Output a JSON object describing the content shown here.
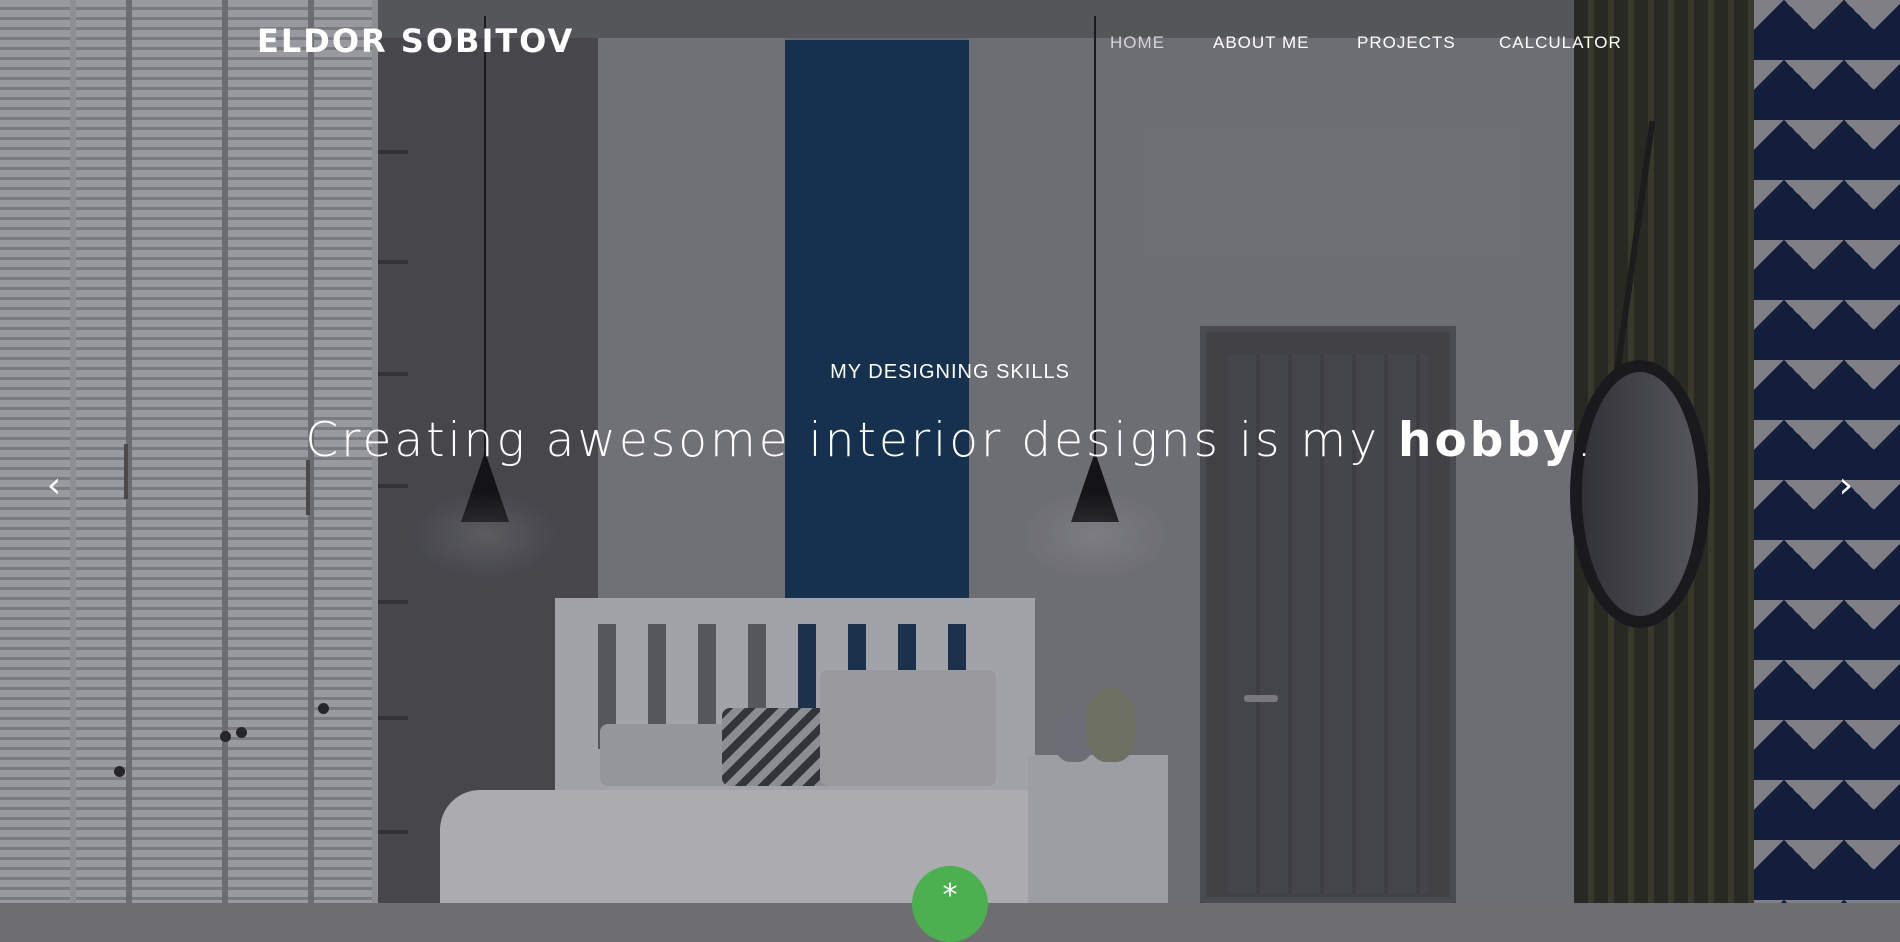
{
  "brand": "ELDOR SOBITOV",
  "nav": {
    "home": "HOME",
    "about": "ABOUT ME",
    "projects": "PROJECTS",
    "calculator": "CALCULATOR",
    "active": "home"
  },
  "hero": {
    "kicker": "MY DESIGNING SKILLS",
    "headline_pre": "Creating awesome interior designs is my ",
    "headline_strong": "hobby",
    "headline_post": "."
  },
  "carousel": {
    "prev_icon": "chevron-left-icon",
    "next_icon": "chevron-right-icon",
    "prev_glyph": "‹",
    "next_glyph": "›"
  },
  "fab": {
    "icon": "asterisk-icon",
    "glyph": "*",
    "color": "#4caf50"
  },
  "colors": {
    "accent_blue": "#13395d",
    "text": "#ffffff"
  }
}
